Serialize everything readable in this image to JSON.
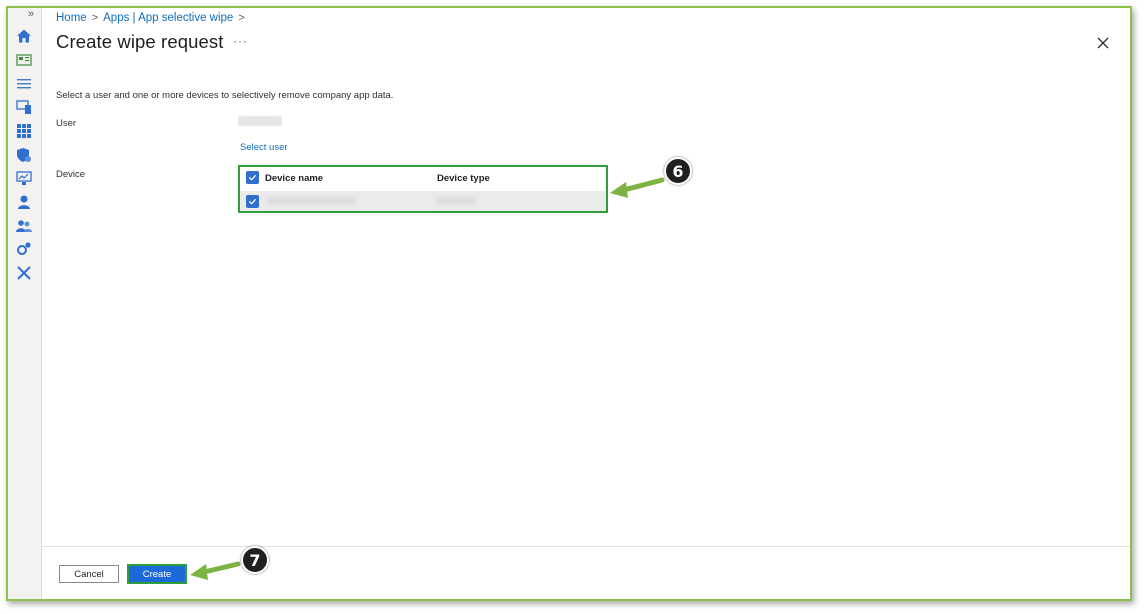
{
  "breadcrumb": {
    "items": [
      "Home",
      "Apps | App selective wipe"
    ],
    "separator": ">"
  },
  "page": {
    "title": "Create wipe request",
    "more_label": "···",
    "description": "Select a user and one or more devices to selectively remove company app data."
  },
  "form": {
    "user_label": "User",
    "select_user_link": "Select user",
    "device_label": "Device"
  },
  "device_table": {
    "columns": [
      "Device name",
      "Device type"
    ],
    "header_checked": true,
    "rows": [
      {
        "checked": true
      }
    ]
  },
  "footer": {
    "cancel_label": "Cancel",
    "create_label": "Create"
  },
  "callouts": [
    "6",
    "7"
  ],
  "sidebar": {
    "expand_label": "»",
    "icons": [
      "home-icon",
      "dashboard-icon",
      "all-services-icon",
      "devices-icon",
      "apps-icon",
      "endpoint-security-icon",
      "reports-icon",
      "users-icon",
      "groups-icon",
      "tenant-admin-icon",
      "troubleshooting-icon"
    ]
  },
  "colors": {
    "accent": "#0f6cbd",
    "primary_button": "#1c6ad8",
    "highlight_border": "#2e9e3f",
    "arrow": "#8bc34a"
  }
}
